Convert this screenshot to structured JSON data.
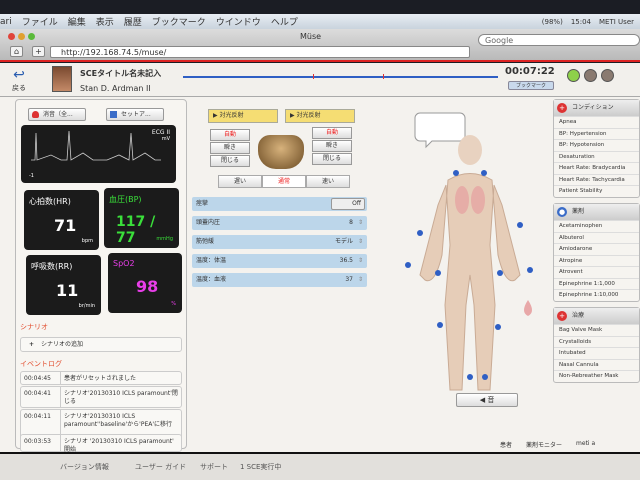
{
  "menubar": {
    "items": [
      "ari",
      "ファイル",
      "編集",
      "表示",
      "履歴",
      "ブックマーク",
      "ウインドウ",
      "ヘルプ"
    ],
    "battery": "(98%)",
    "time": "15:04",
    "user": "METI User"
  },
  "browser": {
    "title": "Müse",
    "url": "http://192.168.74.5/muse/",
    "search_placeholder": "Google",
    "add": "+"
  },
  "header": {
    "back": "戻る",
    "title": "SCEタイトル名未記入",
    "name": "Stan D. Ardman II",
    "timer": "00:07:22",
    "bookmark": "ブックマーク"
  },
  "left": {
    "alarm_btn": "消音（全...",
    "setup_btn": "セットア...",
    "ecg": {
      "label": "ECG II",
      "unit": "mV",
      "scale": "-1"
    },
    "vitals": [
      {
        "label": "心拍数(HR)",
        "value": "71",
        "unit": "bpm"
      },
      {
        "label": "血圧(BP)",
        "value": "117 / 77",
        "unit": "mmHg"
      },
      {
        "label": "呼吸数(RR)",
        "value": "11",
        "unit": "br/min"
      },
      {
        "label": "SpO2",
        "value": "98",
        "unit": "%"
      }
    ],
    "scenario_title": "シナリオ",
    "add_scenario": "シナリオの追加",
    "eventlog_title": "イベントログ",
    "events": [
      {
        "time": "00:04:45",
        "msg": "患者がリセットされました"
      },
      {
        "time": "00:04:41",
        "msg": "シナリオ'20130310 ICLS paramount'閉じる"
      },
      {
        "time": "00:04:11",
        "msg": "シナリオ'20130310 ICLS paramount''baseline'から'PEA'に移行"
      },
      {
        "time": "00:03:53",
        "msg": "シナリオ '20130310 ICLS paramount' 開始"
      }
    ]
  },
  "eyes": {
    "reflex": "対光反射",
    "auto": "自動",
    "blink": "瞬き",
    "close": "閉じる",
    "speed": [
      "遅い",
      "通常",
      "速い"
    ]
  },
  "params": [
    {
      "label": "痙攣",
      "value": "Off"
    },
    {
      "label": "頭蓋内圧",
      "value": "8"
    },
    {
      "label": "筋弛緩",
      "value": "モデル"
    },
    {
      "label": "温度：体温",
      "value": "36.5"
    },
    {
      "label": "温度：血液",
      "value": "37"
    }
  ],
  "body": {
    "sound": "音"
  },
  "right": {
    "conditions": {
      "title": "コンディション",
      "items": [
        "Apnea",
        "BP: Hypertension",
        "BP: Hypotension",
        "Desaturation",
        "Heart Rate: Bradycardia",
        "Heart Rate: Tachycardia",
        "Patient Stability"
      ]
    },
    "drugs": {
      "title": "薬剤",
      "items": [
        "Acetaminophen",
        "Albuterol",
        "Amiodarone",
        "Atropine",
        "Atrovent",
        "Epinephrine 1:1,000",
        "Epinephrine 1:10,000"
      ]
    },
    "treatments": {
      "title": "治療",
      "items": [
        "Bag Valve Mask",
        "Crystalloids",
        "Intubated",
        "Nasal Cannula",
        "Non-Rebreather Mask"
      ]
    }
  },
  "footer": {
    "version": "バージョン情報",
    "guide": "ユーザー ガイド",
    "support": "サポート",
    "status": "1 SCE実行中",
    "patient": "患者",
    "monitor": "薬剤モニター",
    "user": "meti a"
  },
  "colors": {
    "accent": "#e24b2b",
    "bp": "#3adf3a",
    "spo2": "#e83ee8",
    "timeline": "#2f5fc4"
  }
}
